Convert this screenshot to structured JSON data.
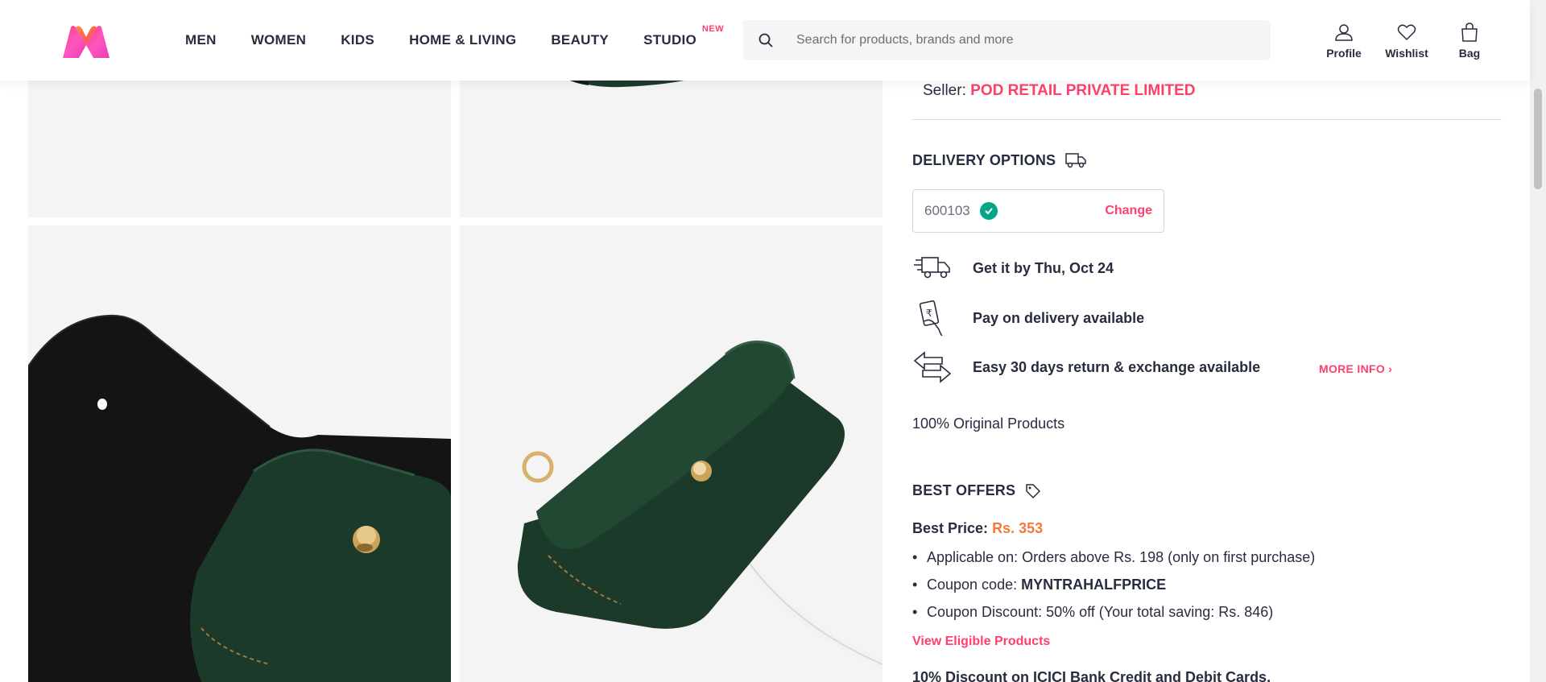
{
  "header": {
    "nav": [
      "MEN",
      "WOMEN",
      "KIDS",
      "HOME & LIVING",
      "BEAUTY",
      "STUDIO"
    ],
    "new_badge": "NEW",
    "search_placeholder": "Search for products, brands and more",
    "actions": [
      "Profile",
      "Wishlist",
      "Bag"
    ]
  },
  "seller": {
    "label": "Seller:",
    "name": "POD RETAIL PRIVATE LIMITED"
  },
  "delivery": {
    "title": "DELIVERY OPTIONS",
    "pincode": "600103",
    "change_label": "Change",
    "items": [
      "Get it by Thu, Oct 24",
      "Pay on delivery available",
      "Easy 30 days return & exchange available"
    ],
    "more_info": "MORE INFO",
    "original": "100% Original Products"
  },
  "offers": {
    "title": "BEST OFFERS",
    "best_price_label": "Best Price:",
    "best_price_value": "Rs. 353",
    "bullet1": "Applicable on: Orders above Rs. 198 (only on first purchase)",
    "bullet2_label": "Coupon code:",
    "bullet2_code": "MYNTRAHALFPRICE",
    "bullet3": "Coupon Discount: 50% off (Your total saving: Rs. 846)",
    "view_eligible": "View Eligible Products",
    "icici": "10% Discount on ICICI Bank Credit and Debit Cards."
  },
  "colors": {
    "accent": "#ff3f6c",
    "price": "#f5793b",
    "check": "#03a685",
    "leather": "#1e3a2b"
  }
}
